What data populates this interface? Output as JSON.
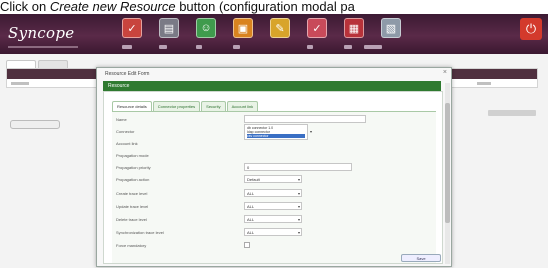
{
  "caption": {
    "prefix": "Click on ",
    "emphasis": "Create new Resource",
    "suffix": " button (configuration modal pa"
  },
  "header": {
    "logo": "Syncope",
    "nav_icons": [
      "users-icon",
      "roles-icon",
      "resources-icon",
      "todo-icon",
      "reports-icon",
      "configuration-icon",
      "tasks-icon",
      "connectors-icon"
    ],
    "logout_icon": "power-icon",
    "brand_color": "#4a2040"
  },
  "modal": {
    "title": "Resource Edit Form",
    "close": "×",
    "header_bar": "Resource",
    "tabs": [
      "Resource details",
      "Connector properties",
      "Security",
      "Account link"
    ],
    "active_tab": 0,
    "fields": [
      {
        "label": "Name",
        "type": "text",
        "value": ""
      },
      {
        "label": "Connector",
        "type": "multi",
        "options": [
          "db connector 1.0",
          "ldap connector",
          "csv connector"
        ]
      },
      {
        "label": "Account link",
        "type": "text",
        "value": ""
      },
      {
        "label": "Propagation mode",
        "type": "text",
        "value": ""
      },
      {
        "label": "Propagation priority",
        "type": "text",
        "value": "0"
      },
      {
        "label": "Propagation action",
        "type": "select",
        "value": "Default"
      },
      {
        "label": "Create trace level",
        "type": "select",
        "value": "ALL"
      },
      {
        "label": "Update trace level",
        "type": "select",
        "value": "ALL"
      },
      {
        "label": "Delete trace level",
        "type": "select",
        "value": "ALL"
      },
      {
        "label": "Synchronization trace level",
        "type": "select",
        "value": "ALL"
      },
      {
        "label": "Force mandatory",
        "type": "checkbox",
        "value": false
      }
    ],
    "save_label": "Save"
  }
}
